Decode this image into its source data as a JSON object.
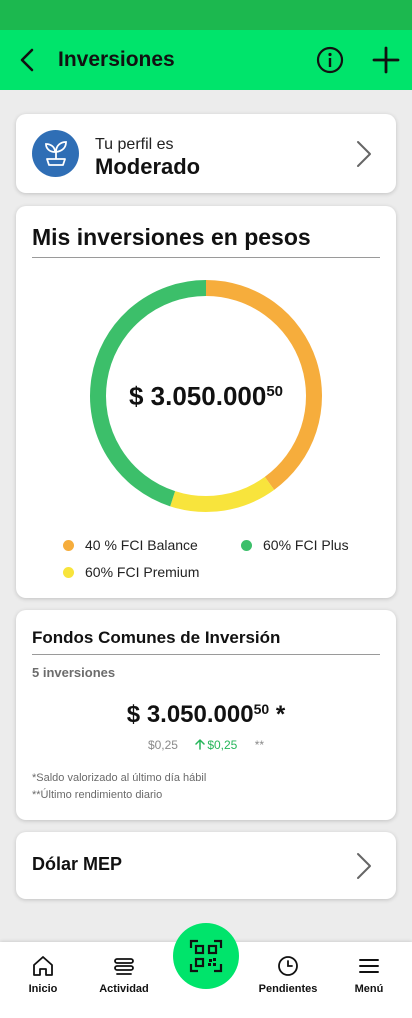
{
  "header": {
    "title": "Inversiones"
  },
  "profile": {
    "label": "Tu perfil es",
    "value": "Moderado"
  },
  "investments": {
    "title": "Mis inversiones en pesos",
    "total_main": "$ 3.050.000",
    "total_cents": "50",
    "segments": [
      {
        "label": "40 % FCI Balance",
        "percent": 40,
        "color": "#f6ad3c"
      },
      {
        "label": "60% FCI Plus",
        "percent": 45,
        "color": "#3cbf6a"
      },
      {
        "label": "60% FCI Premium",
        "percent": 15,
        "color": "#f8e43c"
      }
    ]
  },
  "funds": {
    "title": "Fondos Comunes de Inversión",
    "count": "5 inversiones",
    "amount_main": "$ 3.050.000",
    "amount_cents": "50",
    "amount_suffix": " *",
    "value_left": "$0,25",
    "value_up": "$0,25",
    "value_right": "**",
    "note1": "*Saldo valorizado al último día hábil",
    "note2": "**Último rendimiento diario"
  },
  "mep": {
    "label": "Dólar MEP"
  },
  "nav": {
    "inicio": "Inicio",
    "actividad": "Actividad",
    "pendientes": "Pendientes",
    "menu": "Menú"
  }
}
